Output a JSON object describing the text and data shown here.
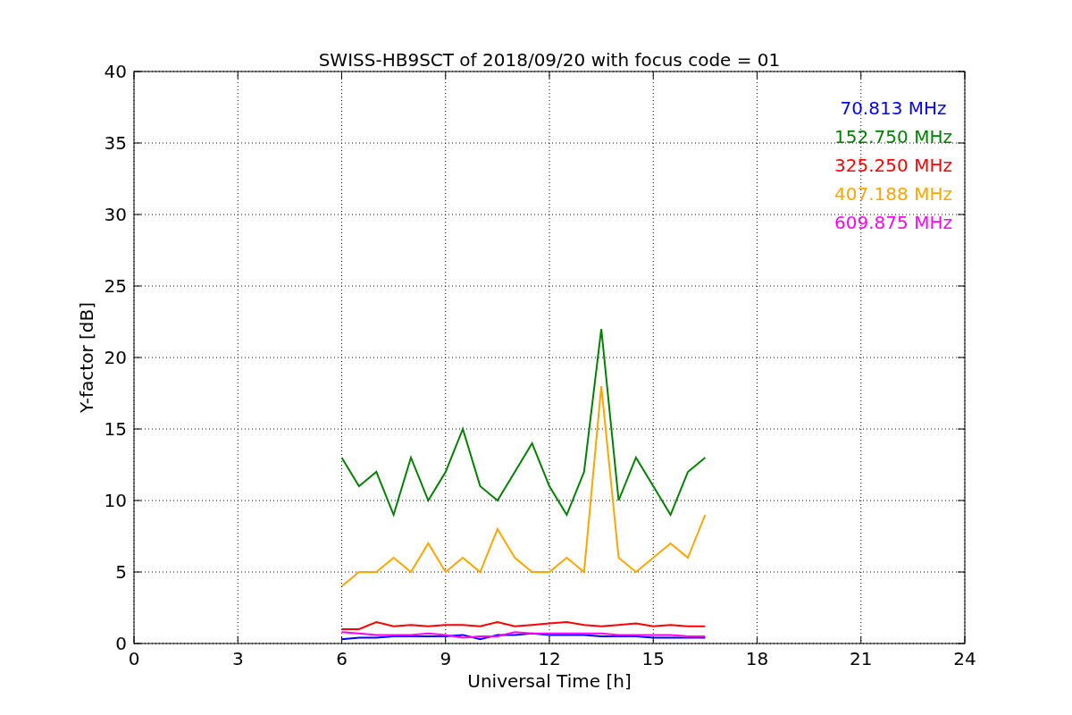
{
  "figure": {
    "chart_data": {
      "type": "line",
      "title": "SWISS-HB9SCT of 2018/09/20 with focus code = 01",
      "xlabel": "Universal Time [h]",
      "ylabel": "Y-factor [dB]",
      "x": [
        6,
        6.5,
        7,
        7.5,
        8,
        8.5,
        9,
        9.5,
        10,
        10.5,
        11,
        11.5,
        12,
        12.5,
        13,
        13.5,
        14,
        14.5,
        15,
        15.5,
        16,
        16.5
      ],
      "series": [
        {
          "name": "70.813 MHz",
          "color": "#0000ff",
          "values": [
            0.3,
            0.4,
            0.4,
            0.5,
            0.5,
            0.5,
            0.5,
            0.6,
            0.3,
            0.6,
            0.6,
            0.7,
            0.6,
            0.6,
            0.6,
            0.5,
            0.5,
            0.5,
            0.4,
            0.4,
            0.4,
            0.4
          ]
        },
        {
          "name": "152.750 MHz",
          "color": "#008000",
          "values": [
            13,
            11,
            12,
            9,
            13,
            10,
            12,
            15,
            11,
            10,
            12,
            14,
            11,
            9,
            12,
            22,
            10,
            13,
            11,
            9,
            12,
            13
          ]
        },
        {
          "name": "325.250 MHz",
          "color": "#ff0000",
          "values": [
            1,
            1,
            1.5,
            1.2,
            1.3,
            1.2,
            1.3,
            1.3,
            1.2,
            1.5,
            1.2,
            1.3,
            1.4,
            1.5,
            1.3,
            1.2,
            1.3,
            1.4,
            1.2,
            1.3,
            1.2,
            1.2
          ]
        },
        {
          "name": "407.188 MHz",
          "color": "#ffa500",
          "values": [
            4,
            5,
            5,
            6,
            5,
            7,
            5,
            6,
            5,
            8,
            6,
            5,
            5,
            6,
            5,
            18,
            6,
            5,
            6,
            7,
            6,
            9
          ]
        },
        {
          "name": "609.875 MHz",
          "color": "#ff00ff",
          "values": [
            0.8,
            0.7,
            0.6,
            0.6,
            0.6,
            0.7,
            0.6,
            0.4,
            0.5,
            0.5,
            0.8,
            0.7,
            0.7,
            0.7,
            0.7,
            0.7,
            0.6,
            0.6,
            0.6,
            0.6,
            0.5,
            0.5
          ]
        }
      ],
      "xlim": [
        0,
        24
      ],
      "ylim": [
        0,
        40
      ],
      "xticks": [
        0,
        3,
        6,
        9,
        12,
        15,
        18,
        21,
        24
      ],
      "yticks": [
        0,
        5,
        10,
        15,
        20,
        25,
        30,
        35,
        40
      ],
      "grid": true
    }
  }
}
